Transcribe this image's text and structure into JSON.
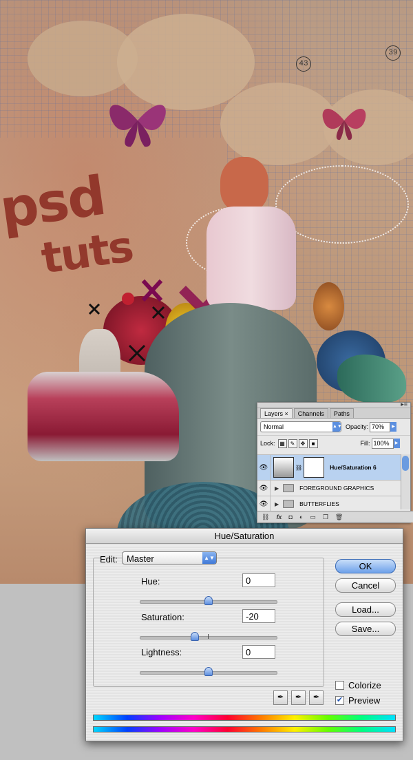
{
  "artwork": {
    "logo_line1": "psd",
    "logo_line2": "tuts",
    "part_numbers": [
      "43",
      "39"
    ]
  },
  "layers_panel": {
    "tabs": [
      "Layers",
      "Channels",
      "Paths"
    ],
    "tab_close_glyph": "×",
    "blend_mode": "Normal",
    "opacity_label": "Opacity:",
    "opacity_value": "70%",
    "lock_label": "Lock:",
    "fill_label": "Fill:",
    "fill_value": "100%",
    "layers": [
      {
        "name": "Hue/Saturation 6",
        "visible": true,
        "selected": true
      },
      {
        "name": "FOREGROUND GRAPHICS",
        "visible": true,
        "selected": false
      },
      {
        "name": "BUTTERFLIES",
        "visible": true,
        "selected": false
      }
    ],
    "bottom_icons": [
      "link-icon",
      "fx-icon",
      "mask-icon",
      "adjustment-icon",
      "folder-icon",
      "new-layer-icon",
      "trash-icon"
    ],
    "bottom_fx_label": "fx"
  },
  "hue_saturation": {
    "title": "Hue/Saturation",
    "edit_label": "Edit:",
    "edit_value": "Master",
    "hue_label": "Hue:",
    "hue_value": "0",
    "saturation_label": "Saturation:",
    "saturation_value": "-20",
    "lightness_label": "Lightness:",
    "lightness_value": "0",
    "buttons": {
      "ok": "OK",
      "cancel": "Cancel",
      "load": "Load...",
      "save": "Save..."
    },
    "colorize_label": "Colorize",
    "colorize_checked": false,
    "preview_label": "Preview",
    "preview_checked": true,
    "slider_levels": {
      "hue": 0,
      "saturation": -20,
      "lightness": 0
    }
  }
}
